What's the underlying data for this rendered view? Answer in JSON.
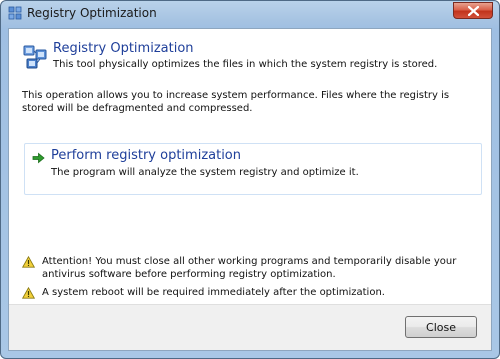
{
  "window": {
    "title": "Registry Optimization"
  },
  "header": {
    "title": "Registry Optimization",
    "subtitle": "This tool physically optimizes the files in which the system registry is stored."
  },
  "description": "This operation allows you to increase system performance. Files where the registry is stored will be defragmented and compressed.",
  "action": {
    "title": "Perform registry optimization",
    "subtitle": "The program will analyze the system registry and optimize it."
  },
  "warnings": [
    "Attention! You must close all other working programs and temporarily disable your antivirus software before performing registry optimization.",
    "A system reboot will be required immediately after the optimization."
  ],
  "footer": {
    "close_label": "Close"
  },
  "icons": {
    "title": "registry-icon",
    "header": "registry-icon",
    "action": "green-arrow-icon",
    "warning": "warning-triangle-icon",
    "window_close": "close-icon"
  },
  "colors": {
    "link_blue": "#1f3f9a",
    "arrow_green": "#2e9b2e",
    "warning_yellow": "#f2d03a"
  }
}
